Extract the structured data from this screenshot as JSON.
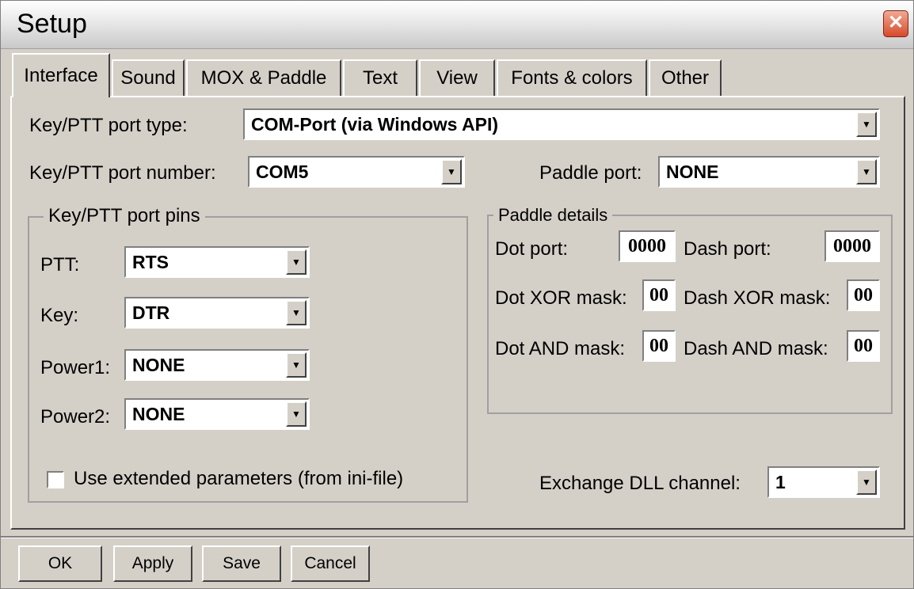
{
  "window": {
    "title": "Setup"
  },
  "tabs": [
    "Interface",
    "Sound",
    "MOX & Paddle",
    "Text",
    "View",
    "Fonts & colors",
    "Other"
  ],
  "interface": {
    "port_type_label": "Key/PTT port type:",
    "port_type_value": "COM-Port (via Windows API)",
    "port_number_label": "Key/PTT port number:",
    "port_number_value": "COM5",
    "paddle_port_label": "Paddle port:",
    "paddle_port_value": "NONE",
    "pins_group": {
      "title": "Key/PTT port pins",
      "ptt_label": "PTT:",
      "ptt_value": "RTS",
      "key_label": "Key:",
      "key_value": "DTR",
      "power1_label": "Power1:",
      "power1_value": "NONE",
      "power2_label": "Power2:",
      "power2_value": "NONE",
      "extended_label": "Use extended parameters (from ini-file)",
      "extended_checked": false
    },
    "paddle_details": {
      "title": "Paddle details",
      "dot_port_label": "Dot port:",
      "dot_port_value": "0000",
      "dash_port_label": "Dash port:",
      "dash_port_value": "0000",
      "dot_xor_label": "Dot XOR mask:",
      "dot_xor_value": "00",
      "dash_xor_label": "Dash XOR mask:",
      "dash_xor_value": "00",
      "dot_and_label": "Dot AND mask:",
      "dot_and_value": "00",
      "dash_and_label": "Dash AND mask:",
      "dash_and_value": "00"
    },
    "exchange_label": "Exchange DLL channel:",
    "exchange_value": "1"
  },
  "buttons": {
    "ok": "OK",
    "apply": "Apply",
    "save": "Save",
    "cancel": "Cancel"
  }
}
